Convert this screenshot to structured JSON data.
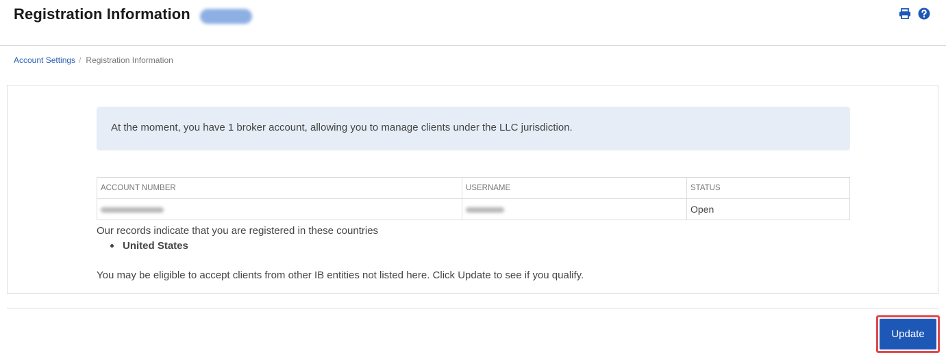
{
  "header": {
    "title": "Registration Information",
    "icons": [
      "print-icon",
      "help-icon"
    ],
    "accent_color": "#1e58b7"
  },
  "breadcrumb": {
    "items": [
      {
        "label": "Account Settings"
      },
      {
        "label": "Registration Information"
      }
    ],
    "separator": "/"
  },
  "panel": {
    "alert_text": "At the moment, you have 1 broker account, allowing you to manage clients under the LLC jurisdiction.",
    "table": {
      "columns": [
        "ACCOUNT NUMBER",
        "USERNAME",
        "STATUS"
      ],
      "rows": [
        {
          "account_number": "",
          "username": "",
          "status": "Open"
        }
      ]
    },
    "records_text": "Our records indicate that you are registered in these countries",
    "countries": [
      "United States"
    ],
    "eligible_text": "You may be eligible to accept clients from other IB entities not listed here. Click Update to see if you qualify."
  },
  "footer": {
    "update_label": "Update"
  }
}
